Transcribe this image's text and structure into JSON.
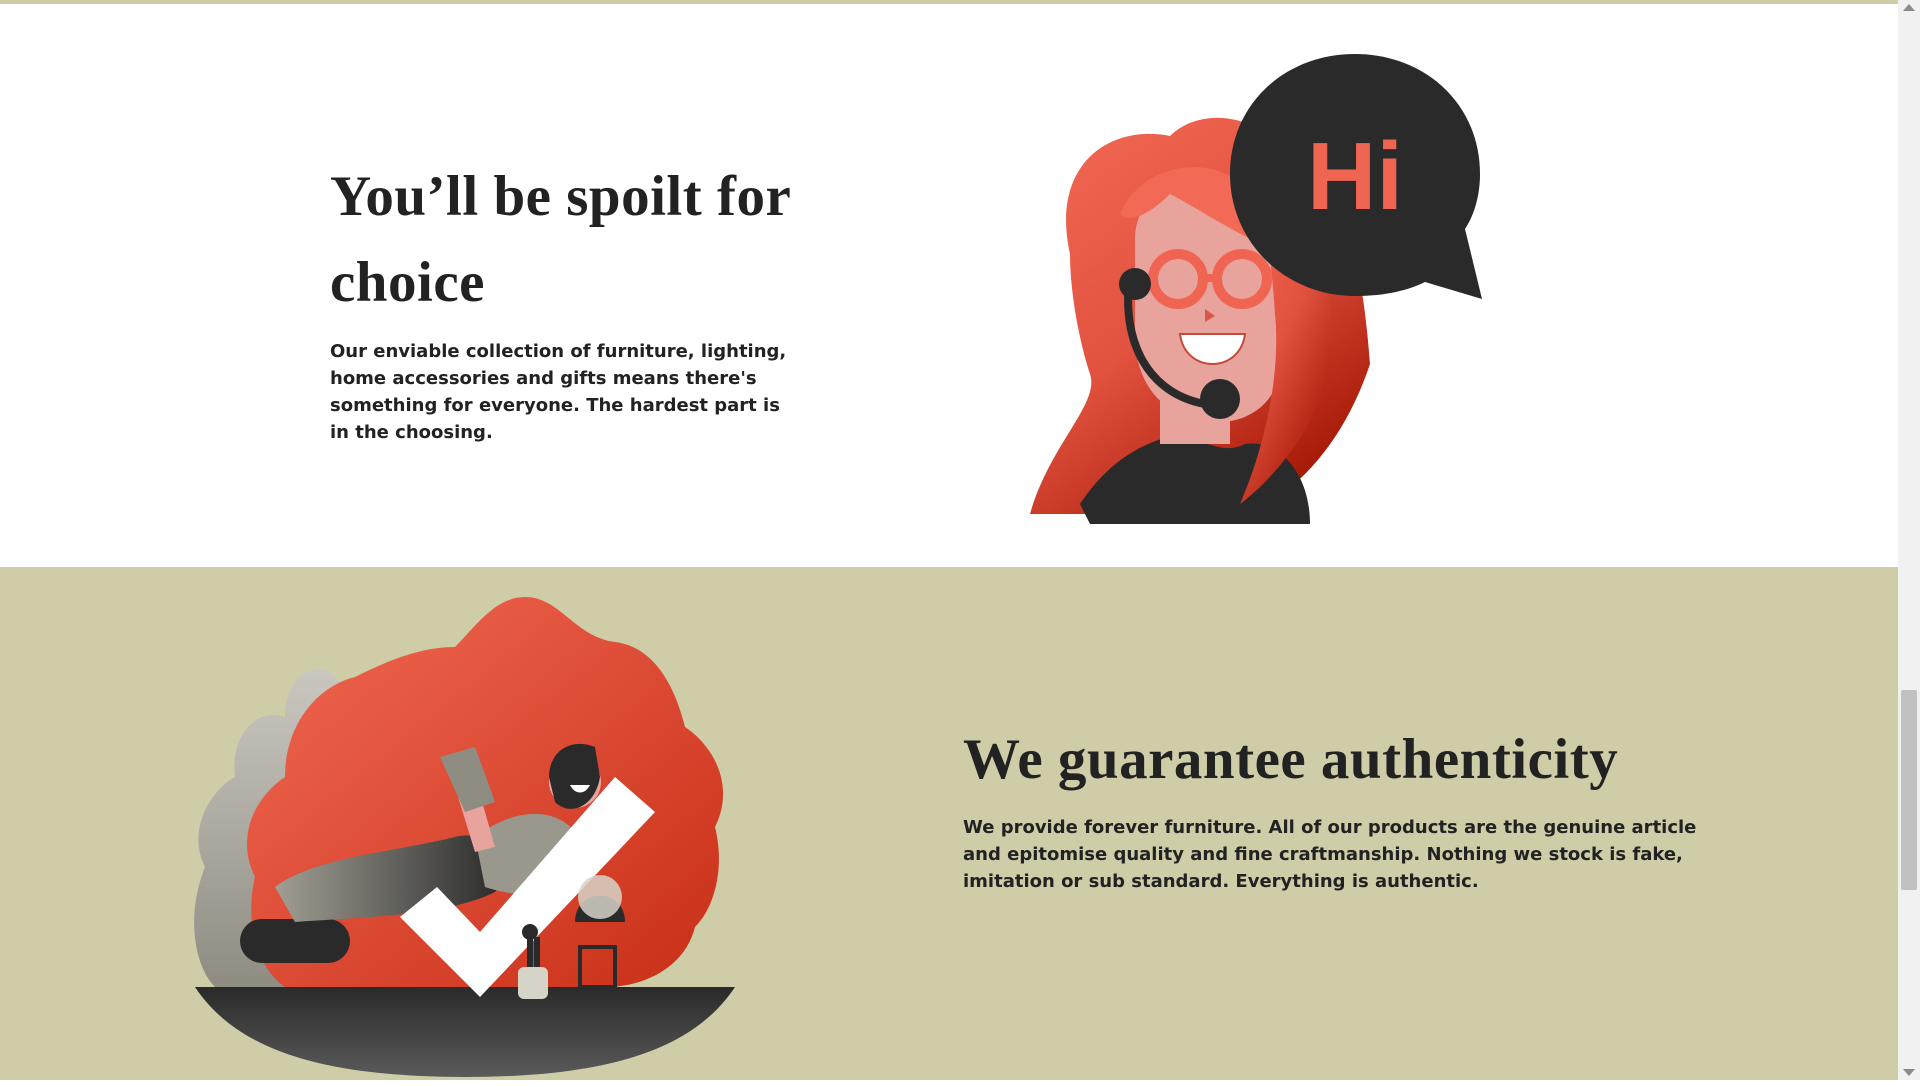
{
  "sections": [
    {
      "title": "You’ll be spoilt for choice",
      "body": "Our enviable collection of furniture, lighting, home accessories and gifts means there's something for everyone. The hardest part is in the choosing.",
      "illustration": "support-agent-with-headset-illustration",
      "bubble_text": "Hi"
    },
    {
      "title": "We guarantee authenticity",
      "body": "We provide forever furniture. All of our products are the genuine article and epitomise quality and fine craftmanship. Nothing we stock is fake, imitation or sub standard. Everything is authentic.",
      "illustration": "man-reading-on-checkmark-illustration"
    }
  ],
  "colors": {
    "section_olive": "#cfcda8",
    "accent_red": "#f06552",
    "dark": "#2a2a2a"
  }
}
